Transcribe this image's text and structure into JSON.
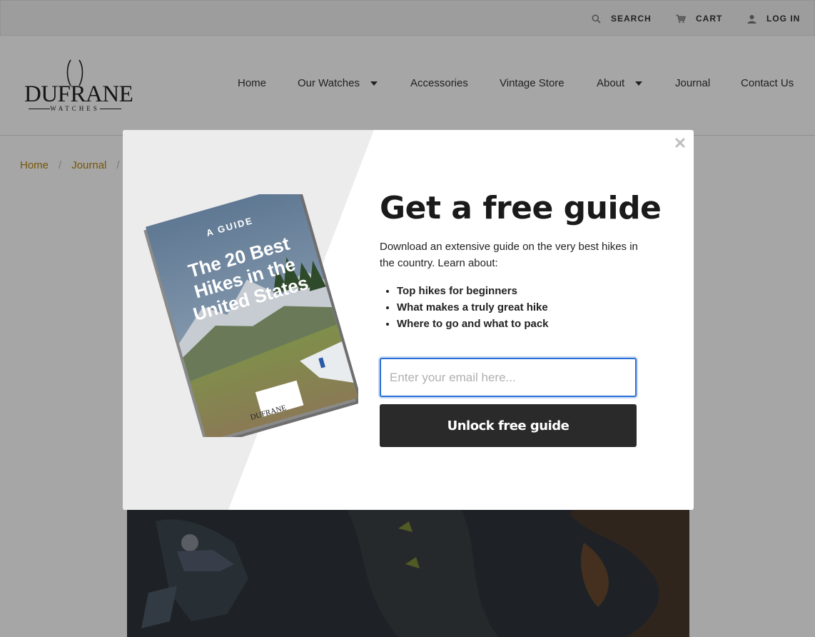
{
  "utility_bar": {
    "search_label": "SEARCH",
    "cart_label": "CART",
    "login_label": "LOG IN"
  },
  "brand": {
    "name": "DUFRANE",
    "tagline": "WATCHES"
  },
  "nav": {
    "items": [
      {
        "label": "Home",
        "dropdown": false
      },
      {
        "label": "Our Watches",
        "dropdown": true
      },
      {
        "label": "Accessories",
        "dropdown": false
      },
      {
        "label": "Vintage Store",
        "dropdown": false
      },
      {
        "label": "About",
        "dropdown": true
      },
      {
        "label": "Journal",
        "dropdown": false
      },
      {
        "label": "Contact Us",
        "dropdown": false
      }
    ]
  },
  "breadcrumb": {
    "items": [
      "Home",
      "Journal"
    ],
    "separator": "/"
  },
  "modal": {
    "close_icon": "close-icon",
    "book": {
      "kicker": "A GUIDE",
      "title_lines": [
        "The 20 Best",
        "Hikes in the",
        "United States"
      ],
      "brand": "DUFRANE"
    },
    "title": "Get a free guide",
    "description": "Download an extensive guide on the very best hikes in the country. Learn about:",
    "bullets": [
      "Top hikes for beginners",
      "What makes a truly great hike",
      "Where to go and what to pack"
    ],
    "email_placeholder": "Enter your email here...",
    "email_value": "",
    "submit_label": "Unlock free guide"
  },
  "colors": {
    "accent_link": "#b8860b",
    "button_dark": "#2a2a2a",
    "focus_blue": "#2b6fd6"
  }
}
